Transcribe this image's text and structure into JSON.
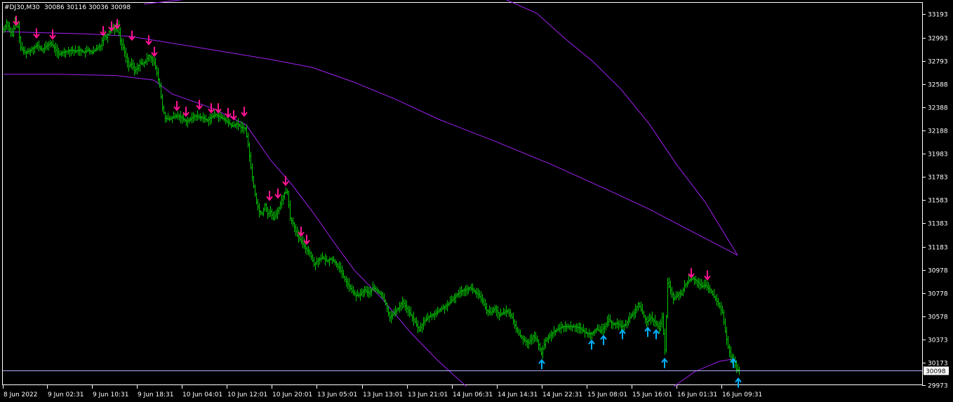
{
  "window": {
    "symbol": "#DJ30,M30",
    "ohlc": "30086 30116 30036 30098"
  },
  "colors": {
    "background": "#000000",
    "frame": "#ffffff",
    "candle": "#00c800",
    "envelope": "#a020f0",
    "sell_arrow": "#ff1493",
    "buy_arrow": "#00b0ff",
    "bid_line": "#b0b0ff"
  },
  "chart_data": {
    "type": "line",
    "y_ticks": [
      "33193",
      "32993",
      "32793",
      "32588",
      "32388",
      "32188",
      "31983",
      "31783",
      "31583",
      "31383",
      "31183",
      "30978",
      "30778",
      "30578",
      "30373",
      "30173",
      "29973"
    ],
    "x_ticks": [
      "8 Jun 2022",
      "9 Jun 02:31",
      "9 Jun 10:31",
      "9 Jun 18:31",
      "10 Jun 04:01",
      "10 Jun 12:01",
      "10 Jun 20:01",
      "13 Jun 05:01",
      "13 Jun 13:01",
      "13 Jun 21:01",
      "14 Jun 06:31",
      "14 Jun 14:31",
      "14 Jun 22:31",
      "15 Jun 08:01",
      "15 Jun 16:01",
      "16 Jun 01:31",
      "16 Jun 09:31"
    ],
    "ylim": [
      29960,
      33240
    ],
    "current_price": "30098",
    "price_path": [
      [
        0,
        33060
      ],
      [
        4,
        33120
      ],
      [
        8,
        33060
      ],
      [
        12,
        33010
      ],
      [
        16,
        33130
      ],
      [
        20,
        33080
      ],
      [
        24,
        32900
      ],
      [
        30,
        32860
      ],
      [
        36,
        32870
      ],
      [
        42,
        32900
      ],
      [
        48,
        32920
      ],
      [
        54,
        32880
      ],
      [
        60,
        32910
      ],
      [
        66,
        32940
      ],
      [
        72,
        32900
      ],
      [
        78,
        32840
      ],
      [
        84,
        32860
      ],
      [
        90,
        32870
      ],
      [
        96,
        32880
      ],
      [
        102,
        32870
      ],
      [
        108,
        32880
      ],
      [
        114,
        32860
      ],
      [
        120,
        32880
      ],
      [
        126,
        32860
      ],
      [
        132,
        32890
      ],
      [
        138,
        32920
      ],
      [
        142,
        33010
      ],
      [
        146,
        32990
      ],
      [
        150,
        33040
      ],
      [
        154,
        33080
      ],
      [
        158,
        33060
      ],
      [
        162,
        33100
      ],
      [
        166,
        32960
      ],
      [
        170,
        32900
      ],
      [
        174,
        32820
      ],
      [
        178,
        32740
      ],
      [
        182,
        32760
      ],
      [
        186,
        32700
      ],
      [
        190,
        32720
      ],
      [
        194,
        32770
      ],
      [
        198,
        32760
      ],
      [
        202,
        32780
      ],
      [
        206,
        32830
      ],
      [
        210,
        32810
      ],
      [
        214,
        32770
      ],
      [
        218,
        32680
      ],
      [
        222,
        32570
      ],
      [
        226,
        32380
      ],
      [
        230,
        32290
      ],
      [
        236,
        32280
      ],
      [
        242,
        32300
      ],
      [
        248,
        32310
      ],
      [
        254,
        32290
      ],
      [
        260,
        32260
      ],
      [
        266,
        32280
      ],
      [
        272,
        32310
      ],
      [
        278,
        32300
      ],
      [
        284,
        32290
      ],
      [
        290,
        32270
      ],
      [
        296,
        32300
      ],
      [
        302,
        32320
      ],
      [
        308,
        32300
      ],
      [
        314,
        32280
      ],
      [
        320,
        32250
      ],
      [
        326,
        32220
      ],
      [
        332,
        32240
      ],
      [
        338,
        32210
      ],
      [
        344,
        32200
      ],
      [
        348,
        32060
      ],
      [
        352,
        31860
      ],
      [
        356,
        31700
      ],
      [
        360,
        31560
      ],
      [
        364,
        31480
      ],
      [
        368,
        31460
      ],
      [
        372,
        31540
      ],
      [
        376,
        31460
      ],
      [
        380,
        31480
      ],
      [
        384,
        31420
      ],
      [
        388,
        31460
      ],
      [
        392,
        31510
      ],
      [
        396,
        31580
      ],
      [
        400,
        31640
      ],
      [
        404,
        31650
      ],
      [
        408,
        31420
      ],
      [
        412,
        31380
      ],
      [
        418,
        31270
      ],
      [
        424,
        31220
      ],
      [
        430,
        31160
      ],
      [
        436,
        31120
      ],
      [
        442,
        31020
      ],
      [
        448,
        31060
      ],
      [
        454,
        31080
      ],
      [
        460,
        31050
      ],
      [
        466,
        31070
      ],
      [
        472,
        31040
      ],
      [
        478,
        30990
      ],
      [
        484,
        30910
      ],
      [
        490,
        30850
      ],
      [
        496,
        30790
      ],
      [
        502,
        30750
      ],
      [
        508,
        30760
      ],
      [
        514,
        30800
      ],
      [
        520,
        30770
      ],
      [
        526,
        30820
      ],
      [
        532,
        30790
      ],
      [
        538,
        30760
      ],
      [
        544,
        30680
      ],
      [
        550,
        30560
      ],
      [
        556,
        30600
      ],
      [
        562,
        30640
      ],
      [
        568,
        30700
      ],
      [
        574,
        30640
      ],
      [
        580,
        30580
      ],
      [
        586,
        30520
      ],
      [
        592,
        30450
      ],
      [
        598,
        30520
      ],
      [
        604,
        30560
      ],
      [
        610,
        30580
      ],
      [
        616,
        30600
      ],
      [
        622,
        30630
      ],
      [
        628,
        30650
      ],
      [
        634,
        30680
      ],
      [
        640,
        30720
      ],
      [
        646,
        30760
      ],
      [
        652,
        30790
      ],
      [
        658,
        30800
      ],
      [
        664,
        30820
      ],
      [
        670,
        30790
      ],
      [
        676,
        30760
      ],
      [
        682,
        30700
      ],
      [
        688,
        30620
      ],
      [
        694,
        30600
      ],
      [
        700,
        30640
      ],
      [
        706,
        30580
      ],
      [
        712,
        30600
      ],
      [
        718,
        30620
      ],
      [
        724,
        30560
      ],
      [
        730,
        30460
      ],
      [
        736,
        30400
      ],
      [
        742,
        30360
      ],
      [
        748,
        30340
      ],
      [
        754,
        30400
      ],
      [
        760,
        30360
      ],
      [
        766,
        30250
      ],
      [
        772,
        30360
      ],
      [
        778,
        30400
      ],
      [
        784,
        30440
      ],
      [
        790,
        30460
      ],
      [
        796,
        30480
      ],
      [
        802,
        30480
      ],
      [
        808,
        30480
      ],
      [
        814,
        30480
      ],
      [
        820,
        30470
      ],
      [
        826,
        30440
      ],
      [
        832,
        30420
      ],
      [
        838,
        30420
      ],
      [
        844,
        30460
      ],
      [
        850,
        30440
      ],
      [
        856,
        30480
      ],
      [
        862,
        30540
      ],
      [
        868,
        30500
      ],
      [
        874,
        30510
      ],
      [
        880,
        30480
      ],
      [
        886,
        30500
      ],
      [
        892,
        30560
      ],
      [
        898,
        30600
      ],
      [
        904,
        30680
      ],
      [
        910,
        30600
      ],
      [
        916,
        30520
      ],
      [
        922,
        30560
      ],
      [
        928,
        30520
      ],
      [
        934,
        30460
      ],
      [
        938,
        30560
      ],
      [
        942,
        30280
      ],
      [
        946,
        30860
      ],
      [
        950,
        30800
      ],
      [
        954,
        30720
      ],
      [
        958,
        30740
      ],
      [
        962,
        30770
      ],
      [
        966,
        30760
      ],
      [
        970,
        30840
      ],
      [
        976,
        30880
      ],
      [
        982,
        30900
      ],
      [
        988,
        30870
      ],
      [
        994,
        30830
      ],
      [
        1000,
        30840
      ],
      [
        1006,
        30800
      ],
      [
        1012,
        30740
      ],
      [
        1018,
        30680
      ],
      [
        1024,
        30600
      ],
      [
        1028,
        30440
      ],
      [
        1032,
        30300
      ],
      [
        1036,
        30220
      ],
      [
        1040,
        30180
      ],
      [
        1044,
        30110
      ],
      [
        1048,
        30098
      ]
    ],
    "envelope_upper_seg1": [
      [
        0,
        33040
      ],
      [
        60,
        33030
      ],
      [
        120,
        33020
      ],
      [
        180,
        33000
      ],
      [
        220,
        32960
      ],
      [
        300,
        32880
      ],
      [
        380,
        32800
      ],
      [
        440,
        32730
      ],
      [
        500,
        32600
      ],
      [
        560,
        32450
      ],
      [
        620,
        32280
      ],
      [
        700,
        32090
      ],
      [
        780,
        31890
      ],
      [
        860,
        31670
      ],
      [
        920,
        31500
      ],
      [
        980,
        31310
      ],
      [
        1040,
        31120
      ],
      [
        1046,
        31100
      ]
    ],
    "envelope_upper_seg2": [
      [
        200,
        33280
      ],
      [
        260,
        33320
      ],
      [
        295,
        33330
      ]
    ],
    "envelope_upper_seg3": [
      [
        715,
        33320
      ],
      [
        760,
        33200
      ],
      [
        800,
        32980
      ],
      [
        840,
        32780
      ],
      [
        880,
        32540
      ],
      [
        920,
        32240
      ],
      [
        960,
        31880
      ],
      [
        1000,
        31560
      ],
      [
        1046,
        31100
      ]
    ],
    "envelope_lower_seg": [
      [
        0,
        32670
      ],
      [
        80,
        32670
      ],
      [
        160,
        32660
      ],
      [
        214,
        32620
      ],
      [
        240,
        32500
      ],
      [
        300,
        32370
      ],
      [
        346,
        32230
      ],
      [
        380,
        31930
      ],
      [
        410,
        31720
      ],
      [
        440,
        31480
      ],
      [
        470,
        31220
      ],
      [
        500,
        30970
      ],
      [
        540,
        30720
      ],
      [
        580,
        30430
      ],
      [
        620,
        30180
      ],
      [
        660,
        29960
      ]
    ],
    "envelope_lower_seg2": [
      [
        955,
        29960
      ],
      [
        985,
        30090
      ],
      [
        1020,
        30180
      ],
      [
        1040,
        30200
      ]
    ],
    "sell_signals": [
      [
        18,
        33130
      ],
      [
        47,
        33020
      ],
      [
        70,
        33010
      ],
      [
        142,
        33040
      ],
      [
        154,
        33080
      ],
      [
        162,
        33100
      ],
      [
        183,
        33000
      ],
      [
        207,
        32960
      ],
      [
        215,
        32860
      ],
      [
        247,
        32390
      ],
      [
        260,
        32340
      ],
      [
        279,
        32400
      ],
      [
        296,
        32370
      ],
      [
        306,
        32370
      ],
      [
        320,
        32330
      ],
      [
        328,
        32310
      ],
      [
        343,
        32340
      ],
      [
        379,
        31610
      ],
      [
        391,
        31630
      ],
      [
        402,
        31740
      ],
      [
        424,
        31300
      ],
      [
        432,
        31230
      ],
      [
        980,
        30940
      ],
      [
        1003,
        30920
      ]
    ],
    "buy_signals": [
      [
        767,
        30160
      ],
      [
        838,
        30330
      ],
      [
        855,
        30370
      ],
      [
        882,
        30420
      ],
      [
        918,
        30440
      ],
      [
        930,
        30420
      ],
      [
        942,
        30170
      ],
      [
        1040,
        30170
      ],
      [
        1047,
        30000
      ]
    ]
  }
}
